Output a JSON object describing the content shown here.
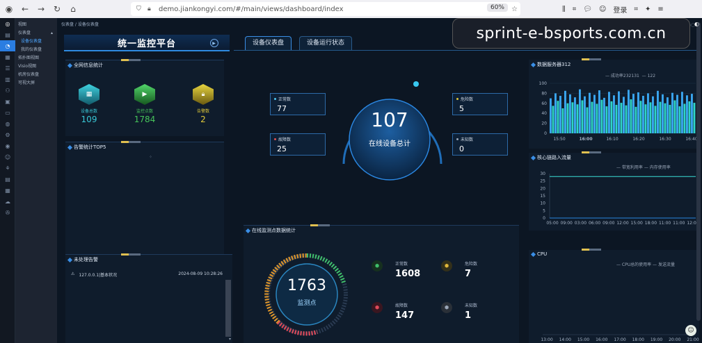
{
  "browser": {
    "url": "demo.jiankongyi.com/#/main/views/dashboard/index",
    "zoom": "60%",
    "login": "登录"
  },
  "sidebar_menu": [
    "视图",
    "仪表盘",
    "设备仪表盘",
    "我的仪表盘",
    "拓扑图视图",
    "Visio视图",
    "机房仪表盘",
    "可视大屏"
  ],
  "breadcrumb": "仪表盘 / 设备仪表盘",
  "header": {
    "title": "统一监控平台",
    "tabs": [
      "设备仪表盘",
      "设备运行状态"
    ]
  },
  "overview": {
    "title": "全网信息统计",
    "stats": [
      {
        "label": "设备总数",
        "value": "109",
        "color": "#39c8d6"
      },
      {
        "label": "监控点数",
        "value": "1784",
        "color": "#46c45a"
      },
      {
        "label": "告警数",
        "value": "2",
        "color": "#e0c93a"
      }
    ]
  },
  "top5": {
    "title": "告警统计TOP5"
  },
  "alerts": {
    "title": "未处理告警",
    "rows": [
      {
        "text": "127.0.0.1|基本状况",
        "time": "2024-08-09 10:28:26"
      }
    ]
  },
  "center": {
    "total": "107",
    "total_label": "在线设备总计",
    "cards": [
      {
        "label": "正常数",
        "value": "77",
        "color": "#4fc6f0"
      },
      {
        "label": "危险数",
        "value": "5",
        "color": "#e0c93a"
      },
      {
        "label": "故障数",
        "value": "25",
        "color": "#e05050"
      },
      {
        "label": "未知数",
        "value": "0",
        "color": "#9aa6b8"
      }
    ]
  },
  "monitor": {
    "title": "在线监测点数据统计",
    "gauge_value": "1763",
    "gauge_label": "监测点",
    "stats": [
      {
        "label": "正常数",
        "value": "1608",
        "color": "#3fbf6a"
      },
      {
        "label": "危险数",
        "value": "7",
        "color": "#e0b73a"
      },
      {
        "label": "故障数",
        "value": "147",
        "color": "#e04a5a"
      },
      {
        "label": "未知数",
        "value": "1",
        "color": "#9aa6b8"
      }
    ]
  },
  "right": {
    "db": {
      "title": "数据服务器312",
      "legend": [
        "成功率232131",
        "122"
      ]
    },
    "link": {
      "title": "核心链路入流量",
      "legend": [
        "带宽利用率",
        "内存使用率"
      ]
    },
    "cpu": {
      "title": "CPU",
      "legend": [
        "CPU总的使用率",
        "发送流量"
      ]
    }
  },
  "chart_data": [
    {
      "type": "bar",
      "title": "数据服务器312",
      "x": [
        "15:50",
        "16:00",
        "16:10",
        "16:20",
        "16:30",
        "16:40"
      ],
      "ylim": [
        0,
        100
      ],
      "yticks": [
        0,
        20,
        40,
        60,
        80,
        100
      ],
      "series": [
        {
          "name": "成功率232131",
          "values": [
            70,
            55,
            80,
            65,
            75,
            50,
            85,
            60,
            78,
            62,
            72,
            58,
            88,
            66,
            74,
            52,
            81,
            63,
            77,
            59,
            86,
            67,
            71,
            54,
            83,
            64,
            76,
            57,
            84,
            61,
            73,
            56,
            87,
            68,
            79,
            53,
            82,
            65,
            75,
            58,
            80,
            62,
            74,
            55,
            85,
            63,
            78,
            60,
            72,
            57,
            81,
            66,
            77,
            54,
            83,
            59,
            76,
            64,
            79,
            61
          ]
        }
      ]
    },
    {
      "type": "line",
      "title": "核心链路入流量",
      "x": [
        "05:00",
        "09:00",
        "03:00",
        "06:00",
        "09:00",
        "12:00",
        "15:00",
        "18:00",
        "11:00",
        "11:00",
        "12:00"
      ],
      "ylim": [
        0,
        30
      ],
      "yticks": [
        0,
        5,
        10,
        15,
        20,
        25,
        30
      ],
      "series": [
        {
          "name": "带宽利用率",
          "values": [
            28,
            28,
            28,
            28,
            28,
            28,
            28,
            28,
            28,
            28,
            28
          ]
        },
        {
          "name": "内存使用率",
          "values": [
            0,
            0,
            0,
            0,
            0,
            0,
            0,
            0,
            0,
            0,
            0
          ]
        }
      ]
    },
    {
      "type": "line",
      "title": "CPU",
      "x": [
        "13:00",
        "14:00",
        "15:00",
        "16:00",
        "17:00",
        "18:00",
        "19:00",
        "20:00",
        "21:00"
      ],
      "series": [
        {
          "name": "CPU总的使用率",
          "values": []
        },
        {
          "name": "发送流量",
          "values": []
        }
      ]
    }
  ],
  "watermark": "sprint-e-bsports.com.cn"
}
